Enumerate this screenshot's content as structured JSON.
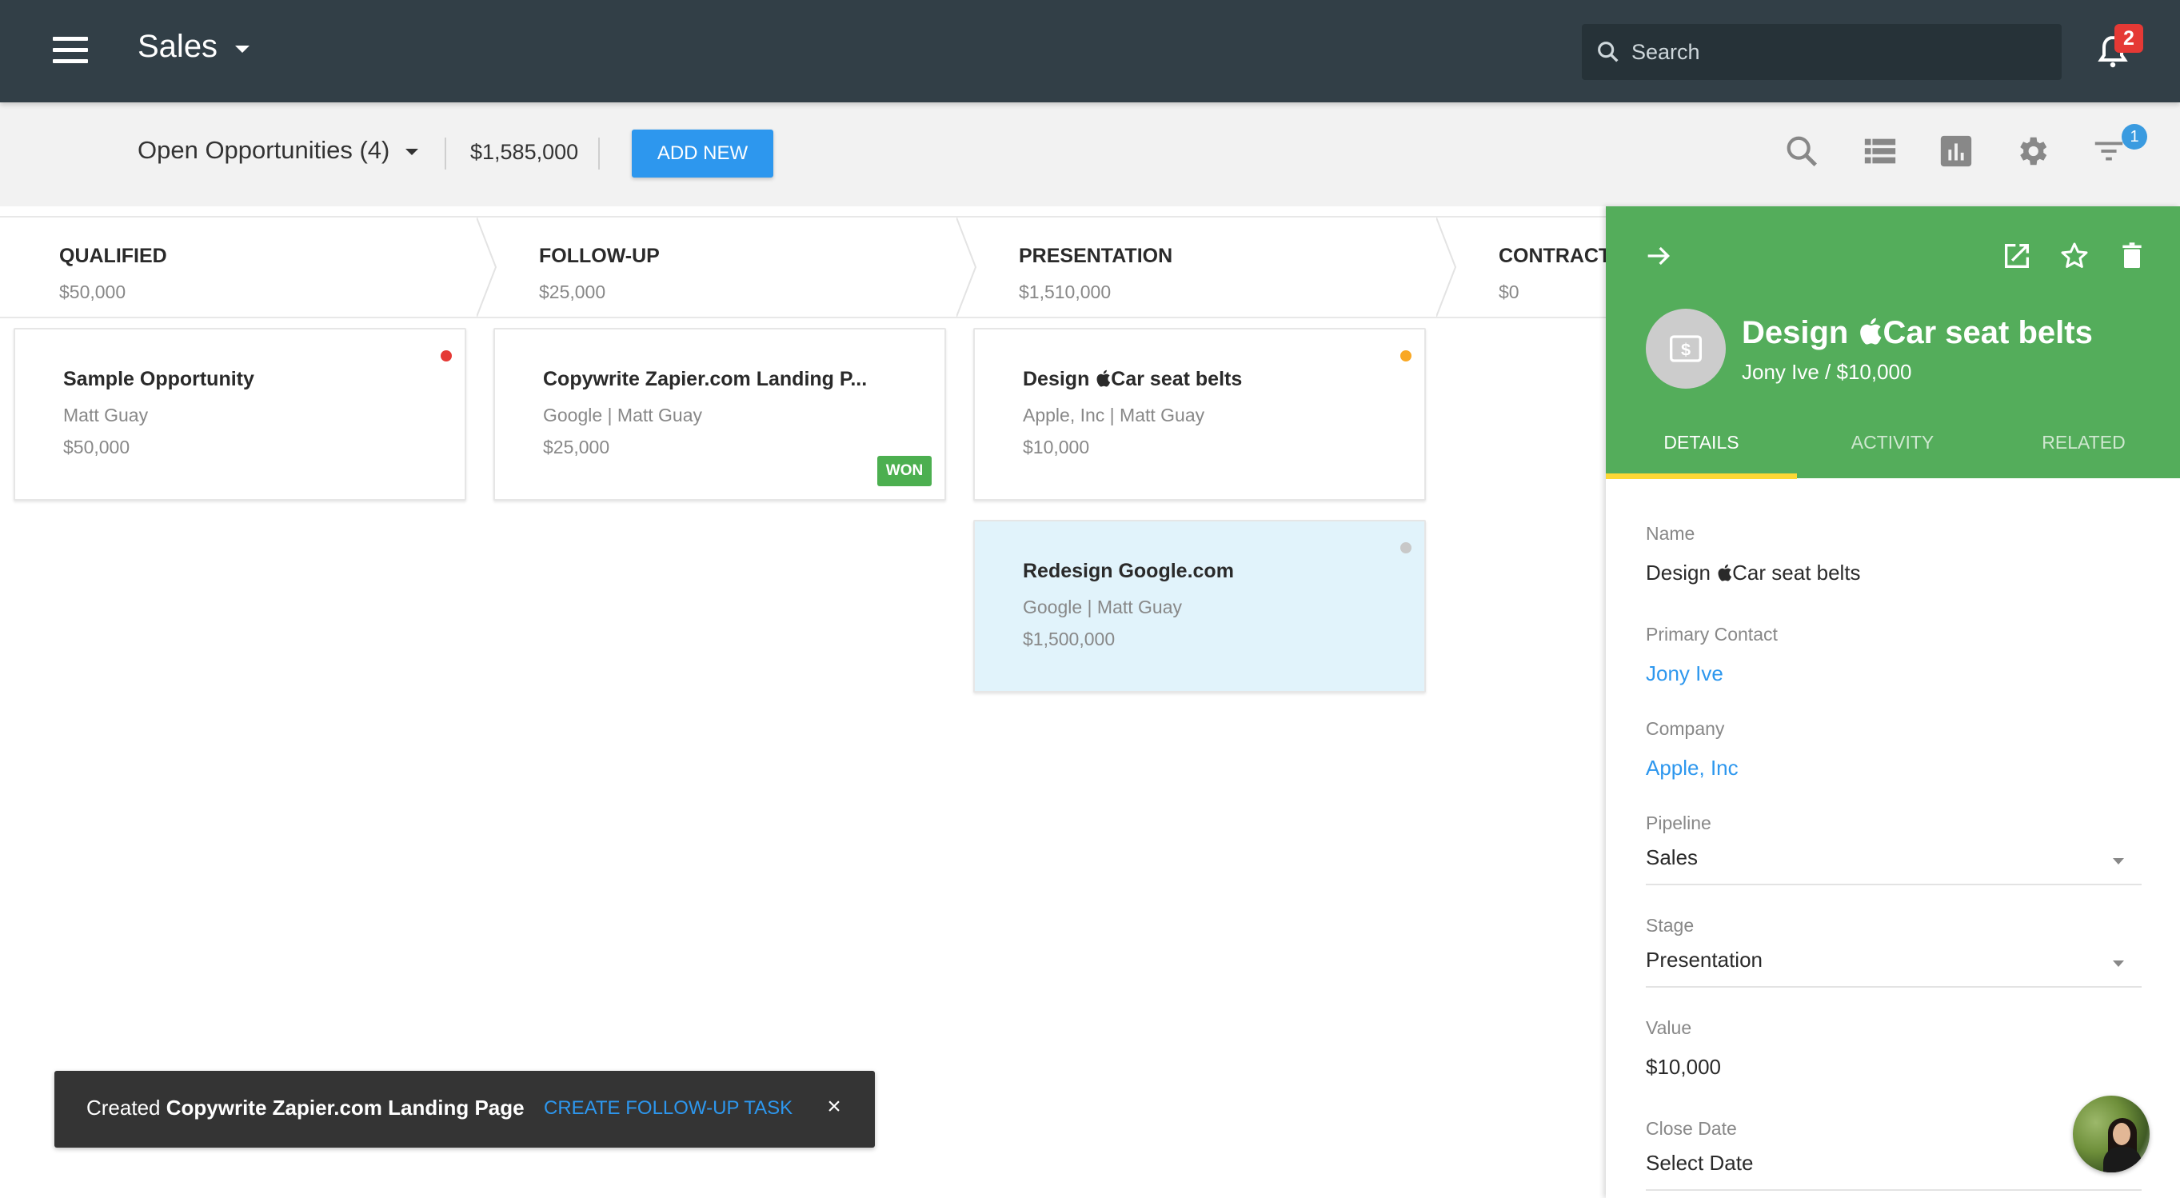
{
  "topbar": {
    "app_title": "Sales",
    "search_placeholder": "Search",
    "notification_count": "2"
  },
  "toolbar": {
    "view_label": "Open Opportunities (4)",
    "total_value": "$1,585,000",
    "add_new_label": "ADD NEW",
    "filter_badge_count": "1",
    "icons": [
      "search-icon",
      "list-view-icon",
      "chart-icon",
      "settings-icon",
      "filter-icon"
    ]
  },
  "stages": [
    {
      "name": "QUALIFIED",
      "total": "$50,000"
    },
    {
      "name": "FOLLOW-UP",
      "total": "$25,000"
    },
    {
      "name": "PRESENTATION",
      "total": "$1,510,000"
    },
    {
      "name": "CONTRACT",
      "total": "$0"
    }
  ],
  "cards": [
    {
      "title": "Sample Opportunity",
      "subtitle": "Matt Guay",
      "value": "$50,000",
      "stage": "QUALIFIED",
      "dot_color": "#e53935"
    },
    {
      "title": "Copywrite Zapier.com Landing P...",
      "subtitle": "Google | Matt Guay",
      "value": "$25,000",
      "stage": "FOLLOW-UP",
      "badge": "WON"
    },
    {
      "title": "Design Car seat belts",
      "title_prefix": "Design ",
      "title_suffix": "Car seat belts",
      "subtitle": "Apple, Inc | Matt Guay",
      "value": "$10,000",
      "stage": "PRESENTATION",
      "dot_color": "#f9a825"
    },
    {
      "title": "Redesign Google.com",
      "subtitle": "Google | Matt Guay",
      "value": "$1,500,000",
      "stage": "PRESENTATION",
      "dot_color": "#c8c8c8",
      "selected": true
    }
  ],
  "panel": {
    "title_prefix": "Design ",
    "title_suffix": "Car seat belts",
    "subtitle": "Jony Ive / $10,000",
    "tabs": [
      {
        "label": "DETAILS",
        "active": true
      },
      {
        "label": "ACTIVITY",
        "active": false
      },
      {
        "label": "RELATED",
        "active": false
      }
    ],
    "fields": {
      "name": {
        "label": "Name",
        "value_prefix": "Design ",
        "value_suffix": "Car seat belts"
      },
      "primary_contact": {
        "label": "Primary Contact",
        "value": "Jony Ive"
      },
      "company": {
        "label": "Company",
        "value": "Apple, Inc"
      },
      "pipeline": {
        "label": "Pipeline",
        "value": "Sales"
      },
      "stage": {
        "label": "Stage",
        "value": "Presentation"
      },
      "value": {
        "label": "Value",
        "value": "$10,000"
      },
      "close_date": {
        "label": "Close Date",
        "value": "Select Date"
      }
    }
  },
  "snackbar": {
    "prefix": "Created ",
    "subject": "Copywrite Zapier.com Landing Page",
    "action_label": "CREATE FOLLOW-UP TASK",
    "close_glyph": "×"
  },
  "colors": {
    "topbar": "#323f47",
    "accent_blue": "#2d97ee",
    "panel_green": "#54ad5b",
    "tab_indicator": "#fdd835",
    "won_green": "#4caf50",
    "highlight_card": "#e1f3fb"
  }
}
